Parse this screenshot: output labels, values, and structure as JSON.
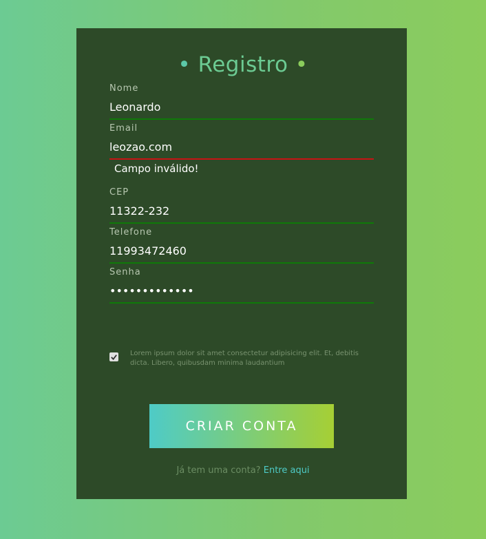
{
  "form": {
    "title": "Registro",
    "title_dot": "•",
    "fields": [
      {
        "label": "Nome",
        "value": "Leonardo"
      },
      {
        "label": "Email",
        "value": "leozao.com"
      },
      {
        "label": "CEP",
        "value": "11322-232"
      },
      {
        "label": "Telefone",
        "value": "11993472460"
      },
      {
        "label": "Senha",
        "value": "•••••••••••••"
      }
    ],
    "email_error": "Campo inválido!",
    "terms_checked": true,
    "terms_text": "Lorem ipsum dolor sit amet consectetur adipisicing elit. Et, debitis dicta. Libero, quibusdam minima laudantium",
    "submit_label": "CRIAR CONTA",
    "login_prompt": "Já tem uma conta?",
    "login_link": "Entre aqui"
  },
  "colors": {
    "card_bg": "#2d4a28",
    "valid_underline": "#0f7a08",
    "invalid_underline": "#c81414",
    "accent_teal": "#4ecbc7",
    "accent_green": "#a6cf34"
  }
}
